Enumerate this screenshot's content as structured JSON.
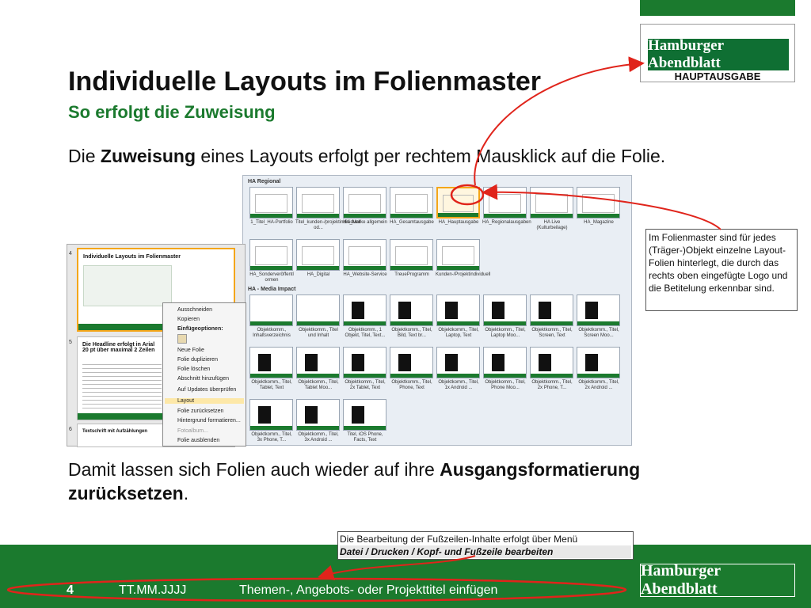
{
  "header": {
    "brand_logo_text": "Hamburger Abendblatt",
    "edition_label": "HAUPTAUSGABE"
  },
  "slide": {
    "title": "Individuelle Layouts im Folienmaster",
    "subtitle": "So erfolgt die Zuweisung",
    "body1": {
      "pre": "Die ",
      "bold": "Zuweisung",
      "post": " eines Layouts erfolgt per rechtem Mausklick auf die Folie."
    },
    "body2": {
      "pre": "Damit lassen sich Folien auch wieder auf ihre ",
      "bold1": "Ausgangsformatierung",
      "bold2": "zurücksetzen",
      "post": "."
    }
  },
  "layout_gallery": {
    "groups": [
      {
        "label": "HA Regional",
        "items": [
          "1_Titel_HA-Portfolio",
          "Titel_kunden-/projektindividuell od...",
          "HA_Marke allgemein",
          "HA_Gesamtausgabe",
          "HA_Hauptausgabe",
          "HA_Regionalausgaben",
          "HA Live (Kulturbeilage)",
          "HA_Magazine",
          "HA_Sonderveröffentl ormen",
          "HA_Digital",
          "HA_Website-Service",
          "TreueProgramm",
          "Kunden-/Projektindividuell"
        ]
      },
      {
        "label": "HA - Media Impact",
        "items": [
          "Objektkomm., Inhaltsverzeichnis",
          "Objektkomm., Titel und Inhalt",
          "Objektkomm., 1 Objekt, Titel, Text...",
          "Objektkomm., Titel, Bild, Text br...",
          "Objektkomm., Titel, Laptop, Text",
          "Objektkomm., Titel, Laptop Moo...",
          "Objektkomm., Titel, Screen, Text",
          "Objektkomm., Titel, Screen Moo...",
          "Objektkomm., Titel, Tablet, Text",
          "Objektkomm., Titel, Tablet Moo...",
          "Objektkomm., Titel, 2x Tablet, Text",
          "Objektkomm., Titel, Phone, Text",
          "Objektkomm., Titel, 1x Android ...",
          "Objektkomm., Titel, Phone Moo...",
          "Objektkomm., Titel, 2x Phone, T...",
          "Objektkomm., Titel, 2x Android ...",
          "Objektkomm., Titel, 3x Phone, T...",
          "Objektkomm., Titel, 3x Android ...",
          "Titel, iOS Phone, Facts, Text"
        ]
      }
    ],
    "selected": "HA_Hauptausgabe"
  },
  "slide_panel": {
    "slides": [
      {
        "num": "4",
        "title": "Individuelle Layouts im Folienmaster"
      },
      {
        "num": "5",
        "title": "Die Headline erfolgt in Arial 20 pt über maximal 2 Zeilen"
      },
      {
        "num": "6",
        "title": "Textschrift mit Aufzählungen"
      }
    ]
  },
  "context_menu": {
    "items": [
      "Ausschneiden",
      "Kopieren",
      "Einfügeoptionen:",
      "Neue Folie",
      "Folie duplizieren",
      "Folie löschen",
      "Abschnitt hinzufügen",
      "Auf Updates überprüfen",
      "Layout",
      "Folie zurücksetzen",
      "Hintergrund formatieren...",
      "Fotoalbum...",
      "Folie ausblenden"
    ],
    "highlighted": "Layout"
  },
  "callout": {
    "text": "Im Folienmaster sind für jedes (Träger-)Objekt einzelne Layout-Folien hinterlegt, die durch das rechts oben eingefügte Logo und die Betitelung erkennbar sind."
  },
  "footer_note": {
    "line1": "Die Bearbeitung der Fußzeilen-Inhalte erfolgt über Menü",
    "line2": "Datei / Drucken / Kopf- und Fußzeile bearbeiten"
  },
  "footer": {
    "page_number": "4",
    "date_placeholder": "TT.MM.JJJJ",
    "title_placeholder": "Themen-, Angebots- oder Projekttitel einfügen",
    "logo_text": "Hamburger Abendblatt"
  },
  "colors": {
    "brand_green": "#1b7a2e",
    "annotation_red": "#e0241b",
    "selection_orange": "#f4a619"
  }
}
